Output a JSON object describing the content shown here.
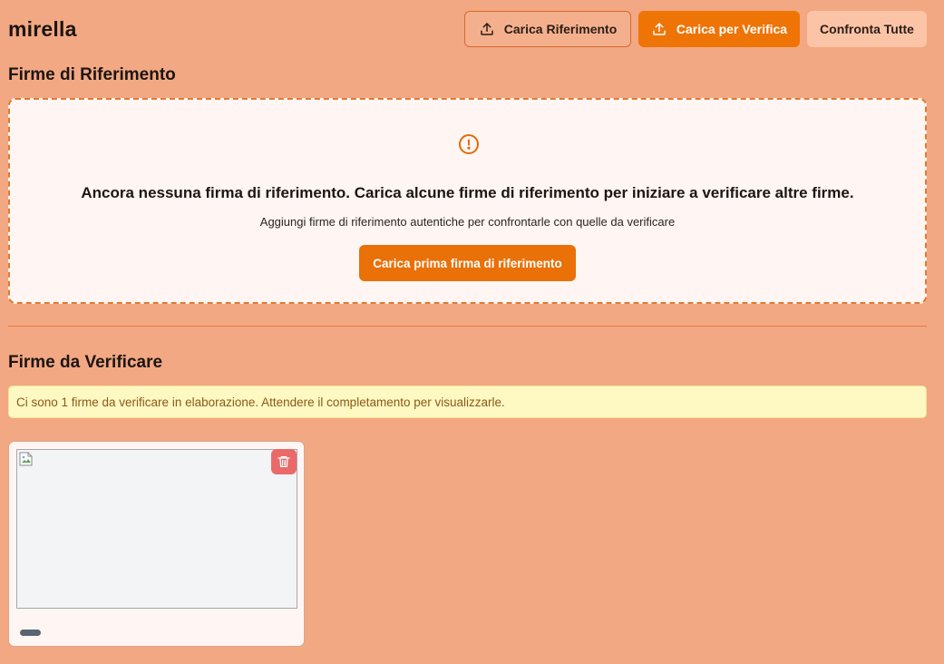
{
  "app": {
    "title": "mirella"
  },
  "toolbar": {
    "upload_reference": {
      "label": "Carica Riferimento",
      "icon": "upload-icon"
    },
    "upload_verify": {
      "label": "Carica per Verifica",
      "icon": "upload-icon"
    },
    "compare_all": {
      "label": "Confronta Tutte"
    }
  },
  "reference_section": {
    "title": "Firme di Riferimento",
    "empty_state": {
      "icon": "alert-circle-icon",
      "heading": "Ancora nessuna firma di riferimento. Carica alcune firme di riferimento per iniziare a verificare altre firme.",
      "subtext": "Aggiungi firme di riferimento autentiche per confrontarle con quelle da verificare",
      "cta_label": "Carica prima firma di riferimento"
    }
  },
  "verify_section": {
    "title": "Firme da Verificare",
    "notice": "Ci sono 1 firme da verificare in elaborazione. Attendere il completamento per visualizzarle.",
    "cards": [
      {
        "image_state": "broken-image",
        "delete_icon": "trash-icon"
      }
    ]
  },
  "colors": {
    "background": "#f2a882",
    "accent": "#ef7406",
    "panel": "#fff6f3",
    "notice_bg": "#fef8c2",
    "notice_text": "#8a5a17",
    "danger": "#ea6a6a"
  }
}
